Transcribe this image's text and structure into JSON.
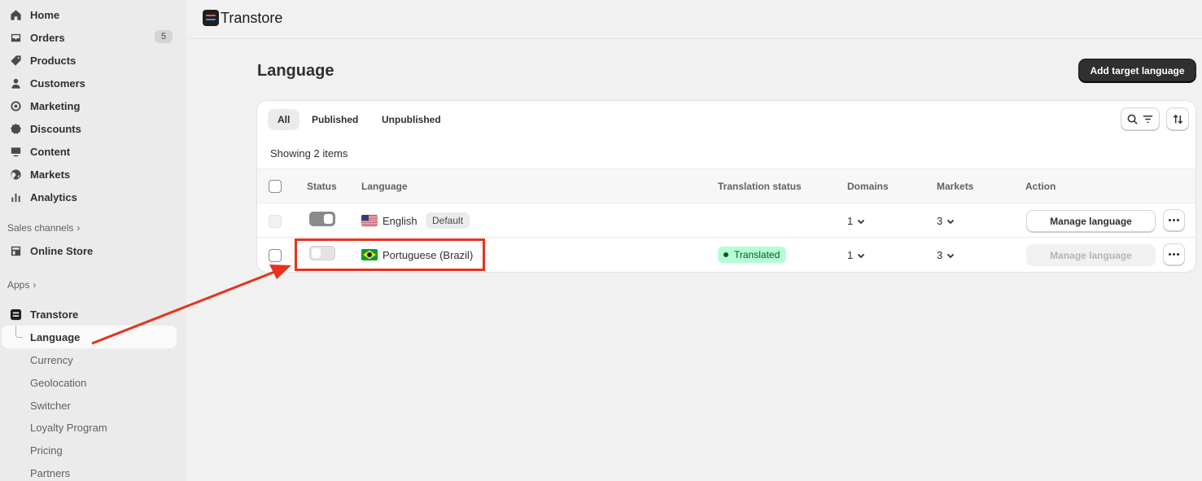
{
  "sidebar": {
    "items": [
      {
        "label": "Home",
        "icon": "home-icon"
      },
      {
        "label": "Orders",
        "icon": "orders-icon",
        "badge": "5"
      },
      {
        "label": "Products",
        "icon": "tag-icon"
      },
      {
        "label": "Customers",
        "icon": "person-icon"
      },
      {
        "label": "Marketing",
        "icon": "target-icon"
      },
      {
        "label": "Discounts",
        "icon": "discount-icon"
      },
      {
        "label": "Content",
        "icon": "content-icon"
      },
      {
        "label": "Markets",
        "icon": "globe-icon"
      },
      {
        "label": "Analytics",
        "icon": "chart-icon"
      }
    ],
    "sales_channels": "Sales channels",
    "online_store": "Online Store",
    "apps": "Apps",
    "app_name": "Transtore",
    "app_subitems": [
      "Language",
      "Currency",
      "Geolocation",
      "Switcher",
      "Loyalty Program",
      "Pricing",
      "Partners"
    ]
  },
  "header": {
    "app_title": "Transtore"
  },
  "page": {
    "title": "Language",
    "add_button": "Add target language",
    "tabs": [
      "All",
      "Published",
      "Unpublished"
    ],
    "showing": "Showing 2 items",
    "columns": [
      "Status",
      "Language",
      "Translation status",
      "Domains",
      "Markets",
      "Action"
    ],
    "rows": [
      {
        "language": "English",
        "badge": "Default",
        "translation_status": "",
        "domains": "1",
        "markets": "3",
        "action": "Manage language",
        "published": true
      },
      {
        "language": "Portuguese (Brazil)",
        "badge": "",
        "translation_status": "Translated",
        "domains": "1",
        "markets": "3",
        "action": "Manage language",
        "published": false
      }
    ]
  },
  "colors": {
    "accent_dark": "#303030",
    "annotation_red": "#e8321e",
    "success_bg": "#b4fed2"
  }
}
